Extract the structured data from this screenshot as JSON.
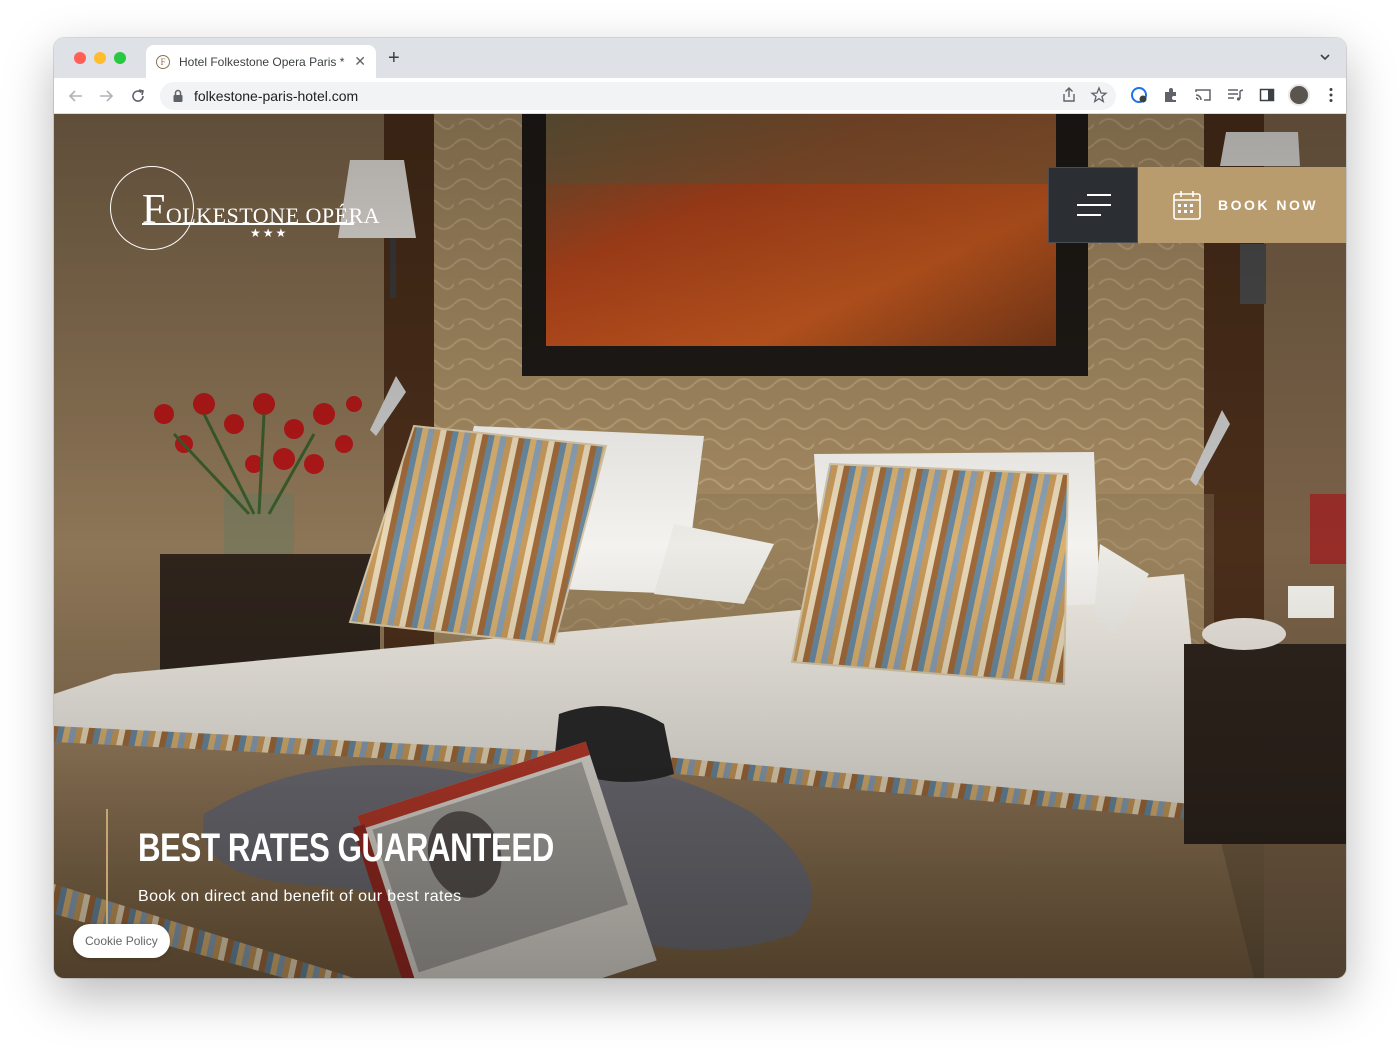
{
  "browser": {
    "tab_title": "Hotel Folkestone Opera Paris *",
    "tab_favicon_letter": "F",
    "url": "folkestone-paris-hotel.com"
  },
  "site": {
    "logo": {
      "initial": "F",
      "name_rest": "OLKESTONE OPÉRA",
      "stars": "★★★"
    },
    "book_label": "BOOK NOW",
    "promo_title": "BEST RATES GUARANTEED",
    "promo_subtitle": "Book on direct and benefit of our best rates",
    "cookie_label": "Cookie Policy"
  }
}
